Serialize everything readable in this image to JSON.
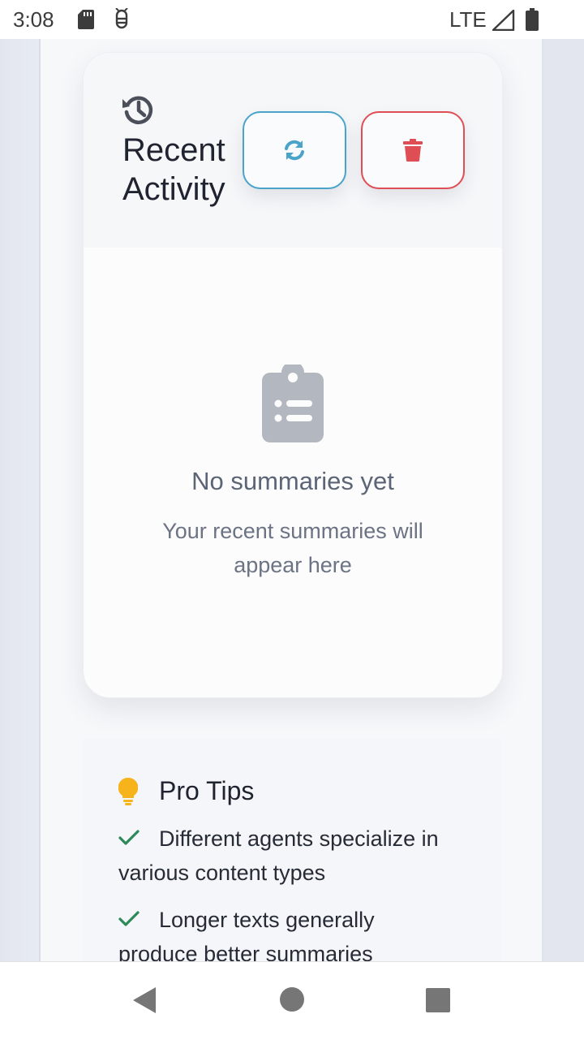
{
  "status_bar": {
    "time": "3:08",
    "network": "LTE",
    "icons": [
      "sd-card-icon",
      "debug-icon",
      "signal-icon",
      "battery-icon"
    ]
  },
  "recent_activity": {
    "title": "Recent Activity",
    "icons": {
      "header": "history-icon",
      "refresh": "refresh-icon",
      "delete": "trash-icon"
    },
    "colors": {
      "refresh": "#4aa3c9",
      "delete": "#df4e54"
    },
    "empty_state": {
      "icon": "clipboard-list-icon",
      "title": "No summaries yet",
      "subtitle": "Your recent summaries will appear here"
    }
  },
  "pro_tips": {
    "title": "Pro Tips",
    "icon": "lightbulb-icon",
    "items": [
      "Different agents specialize in various content types",
      "Longer texts generally produce better summaries"
    ]
  },
  "nav_bar": {
    "icons": [
      "back-icon",
      "home-icon",
      "recents-icon"
    ]
  }
}
